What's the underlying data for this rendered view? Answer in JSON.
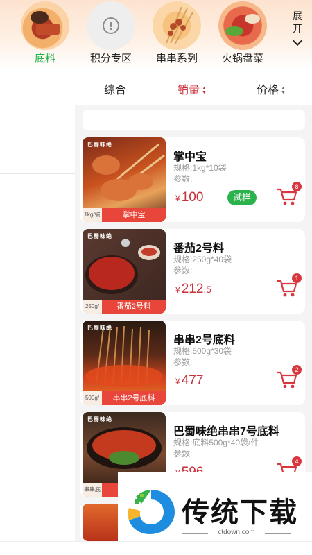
{
  "categories": [
    {
      "label": "底料",
      "active": true
    },
    {
      "label": "积分专区",
      "active": false
    },
    {
      "label": "串串系列",
      "active": false
    },
    {
      "label": "火锅盘菜",
      "active": false
    }
  ],
  "expand_label": "展开",
  "sort_tabs": [
    {
      "label": "综合"
    },
    {
      "label": "销量",
      "active": true
    },
    {
      "label": "价格"
    }
  ],
  "currency": "¥",
  "products": [
    {
      "name": "掌中宝",
      "spec": "规格:1kg*10袋",
      "param": "参数:",
      "price_int": "100",
      "price_dec": "",
      "trial": "试样",
      "cart_count": "8",
      "thumb_brand": "巴蜀味绝",
      "thumb_pack": "1kg/袋",
      "thumb_label": "掌中宝"
    },
    {
      "name": "番茄2号料",
      "spec": "规格:250g*40袋",
      "param": "参数:",
      "price_int": "212",
      "price_dec": ".5",
      "trial": "",
      "cart_count": "1",
      "thumb_brand": "巴蜀味绝",
      "thumb_pack": "250g/袋",
      "thumb_label": "番茄2号料"
    },
    {
      "name": "串串2号底料",
      "spec": "规格:500g*30袋",
      "param": "参数:",
      "price_int": "477",
      "price_dec": "",
      "trial": "",
      "cart_count": "2",
      "thumb_brand": "巴蜀味绝",
      "thumb_pack": "500g/袋",
      "thumb_label": "串串2号底料"
    },
    {
      "name": "巴蜀味绝串串7号底料",
      "spec": "规格:底料500g*40袋/件",
      "param": "参数:",
      "price_int": "596",
      "price_dec": "",
      "trial": "",
      "cart_count": "4",
      "thumb_brand": "巴蜀味绝",
      "thumb_pack": "串串底料",
      "thumb_label": "巴蜀味绝"
    }
  ],
  "watermark": {
    "text": "传统下载",
    "url": "ctdown.com"
  },
  "colors": {
    "accent": "#c8303a",
    "active_category": "#1fb347",
    "trial": "#2bb24c",
    "tag": "#e8463b"
  }
}
